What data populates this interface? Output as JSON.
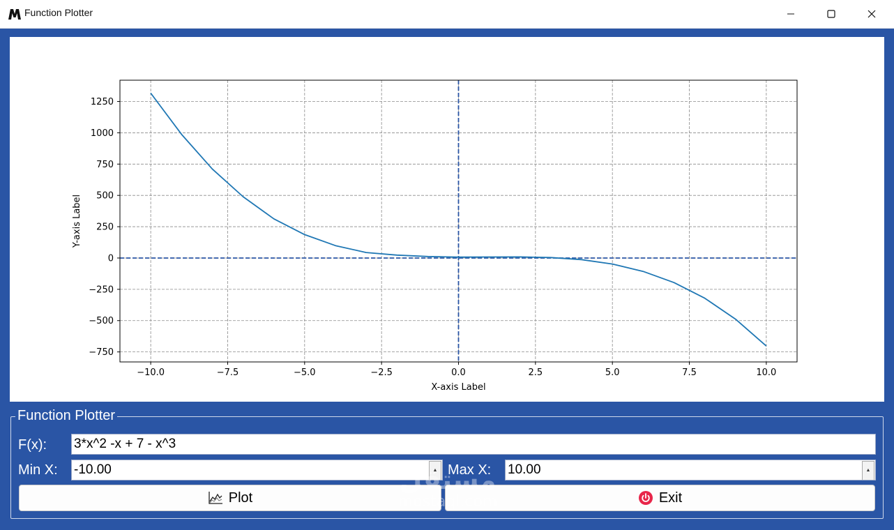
{
  "window": {
    "title": "Function Plotter",
    "logo_icon": "m-logo-icon",
    "controls": [
      "minimize-icon",
      "maximize-icon",
      "close-icon"
    ]
  },
  "chart_data": {
    "type": "line",
    "function": "3*x^2 -x + 7 - x^3",
    "xlabel": "X-axis Label",
    "ylabel": "Y-axis Label",
    "xlim": [
      -11,
      11
    ],
    "ylim": [
      -830,
      1420
    ],
    "x_ticks": [
      -10,
      -7.5,
      -5,
      -2.5,
      0,
      2.5,
      5,
      7.5,
      10
    ],
    "x_tick_labels": [
      "−10.0",
      "−7.5",
      "−5.0",
      "−2.5",
      "0.0",
      "2.5",
      "5.0",
      "7.5",
      "10.0"
    ],
    "y_ticks": [
      -750,
      -500,
      -250,
      0,
      250,
      500,
      750,
      1000,
      1250
    ],
    "y_tick_labels": [
      "−750",
      "−500",
      "−250",
      "0",
      "250",
      "500",
      "750",
      "1000",
      "1250"
    ],
    "grid": true,
    "axis_lines": {
      "x": 0,
      "y": 0,
      "color": "#2a55a5",
      "style": "dashed"
    },
    "series": [
      {
        "color": "#1f77b4",
        "x": [
          -10,
          -9,
          -8,
          -7,
          -6,
          -5,
          -4,
          -3,
          -2,
          -1,
          0,
          1,
          2,
          3,
          4,
          5,
          6,
          7,
          8,
          9,
          10
        ],
        "y": [
          1317,
          988,
          711,
          490,
          313,
          187,
          99,
          44,
          23,
          12,
          7,
          8,
          9,
          4,
          -13,
          -48,
          -107,
          -196,
          -321,
          -488,
          -703
        ]
      }
    ]
  },
  "controls": {
    "group_title": "Function Plotter",
    "fx_label": "F(x):",
    "fx_value": "3*x^2 -x + 7 - x^3",
    "min_label": "Min X:",
    "min_value": "-10.00",
    "max_label": "Max X:",
    "max_value": "10.00",
    "plot_label": "Plot",
    "plot_icon": "line-chart-icon",
    "exit_label": "Exit",
    "exit_icon": "power-icon"
  },
  "watermark": {
    "main": "مستقل",
    "sub": "mostaql.com"
  },
  "colors": {
    "frame": "#2a55a5",
    "curve": "#1f77b4",
    "exit_icon": "#e8264a"
  }
}
